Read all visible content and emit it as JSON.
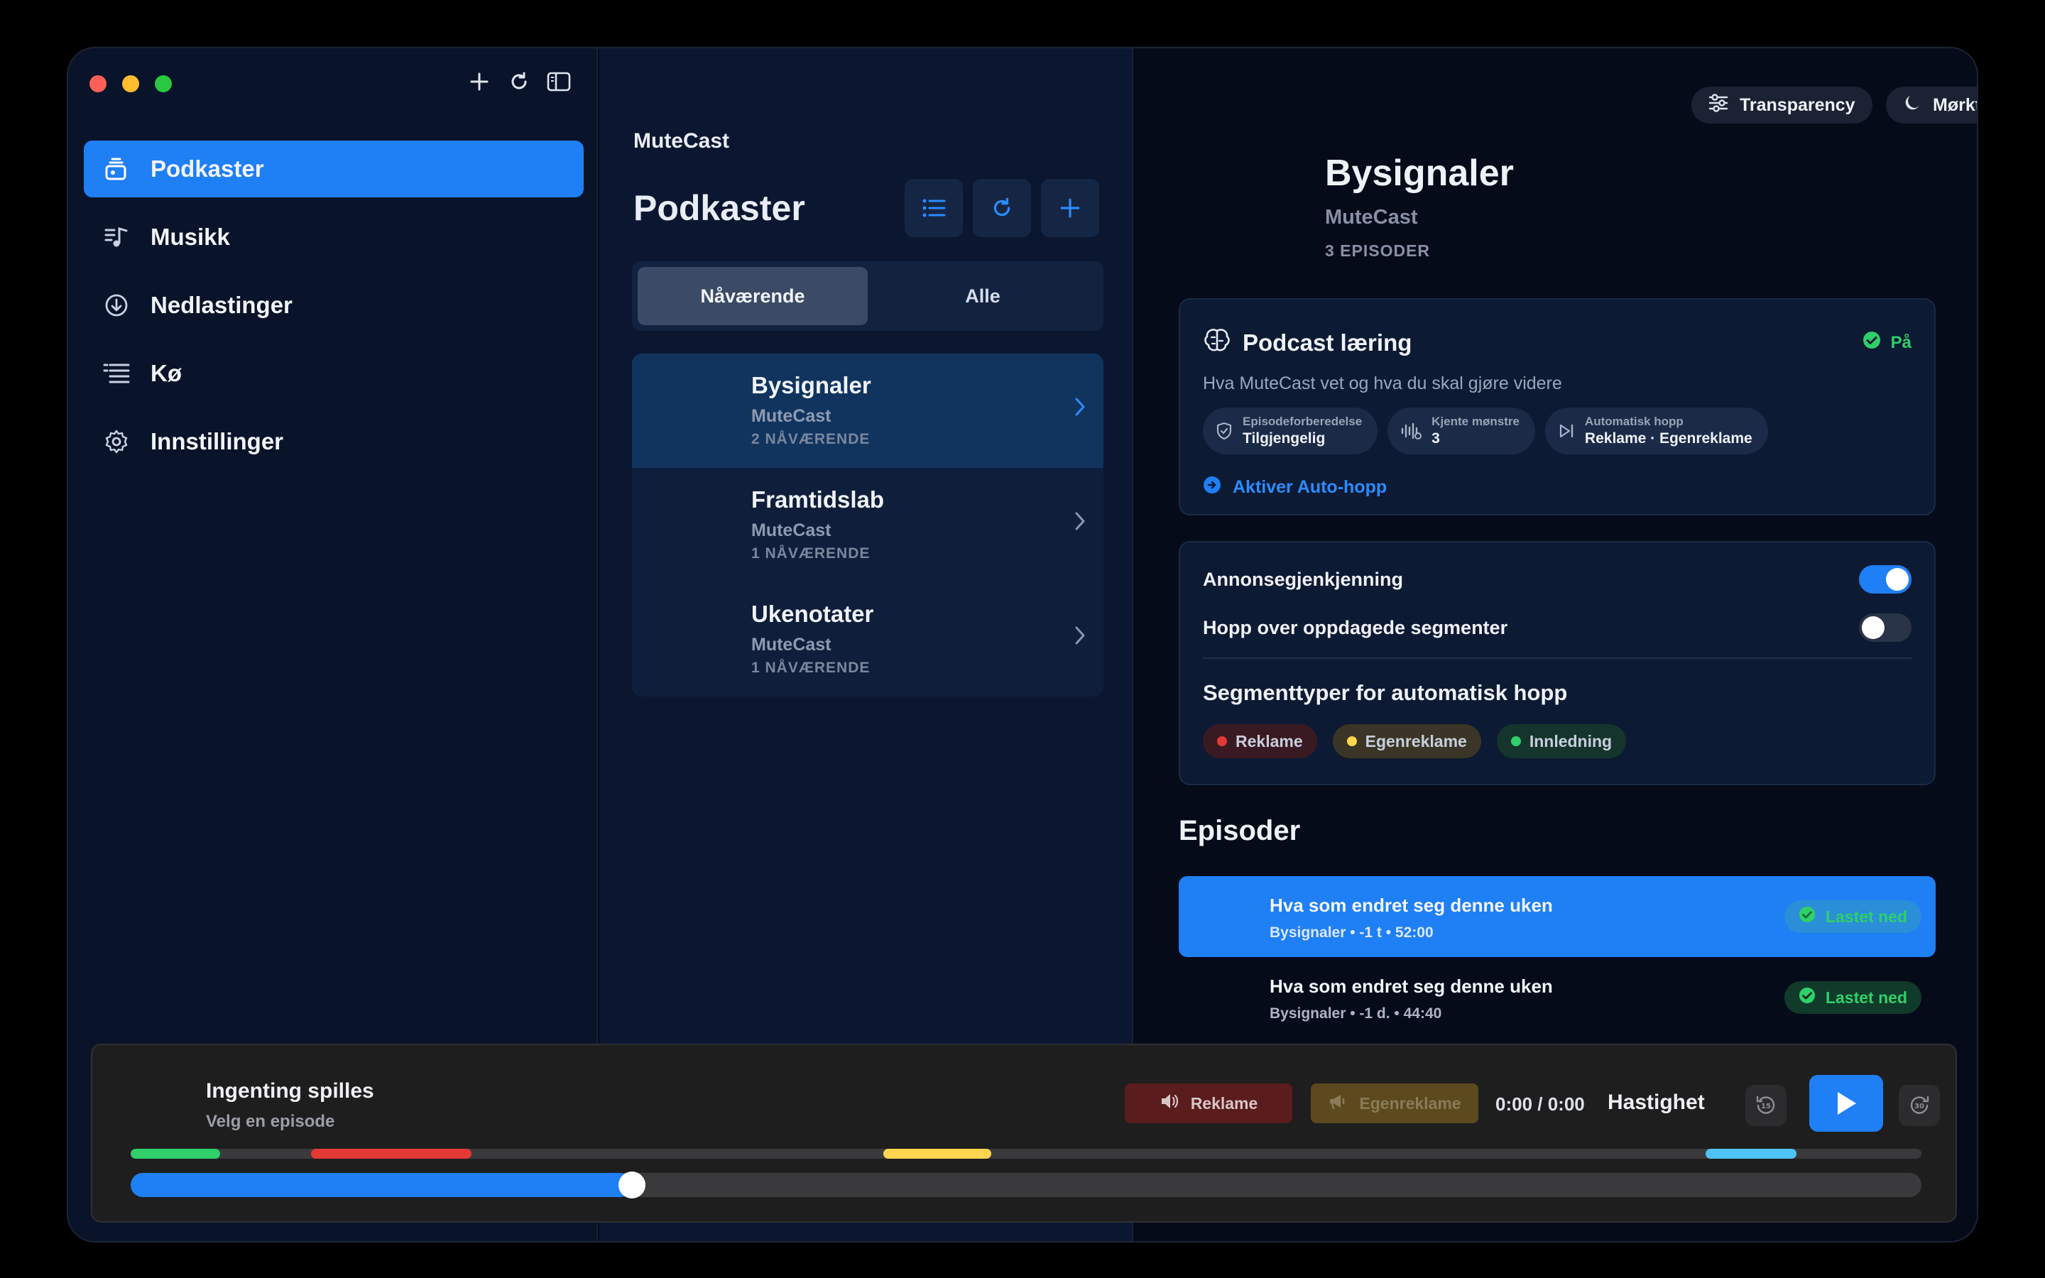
{
  "sidebar": {
    "items": [
      {
        "label": "Podkaster",
        "icon": "podcasts-icon"
      },
      {
        "label": "Musikk",
        "icon": "music-icon"
      },
      {
        "label": "Nedlastinger",
        "icon": "download-icon"
      },
      {
        "label": "Kø",
        "icon": "queue-icon"
      },
      {
        "label": "Innstillinger",
        "icon": "gear-icon"
      }
    ],
    "active_index": 0
  },
  "list": {
    "app_label": "MuteCast",
    "title": "Podkaster",
    "tabs": [
      "Nåværende",
      "Alle"
    ],
    "active_tab": 0,
    "podcasts": [
      {
        "title": "Bysignaler",
        "author": "MuteCast",
        "count": "2 NÅVÆRENDE"
      },
      {
        "title": "Framtidslab",
        "author": "MuteCast",
        "count": "1 NÅVÆRENDE"
      },
      {
        "title": "Ukenotater",
        "author": "MuteCast",
        "count": "1 NÅVÆRENDE"
      }
    ]
  },
  "detail": {
    "transparency_label": "Transparency",
    "theme_label": "Mørkt",
    "title": "Bysignaler",
    "author": "MuteCast",
    "episode_count": "3 EPISODER",
    "learning": {
      "title": "Podcast læring",
      "status": "På",
      "subtitle": "Hva MuteCast vet og hva du skal gjøre videre",
      "chips": [
        {
          "label": "Episodeforberedelse",
          "value": "Tilgjengelig"
        },
        {
          "label": "Kjente mønstre",
          "value": "3"
        },
        {
          "label": "Automatisk hopp",
          "value": "Reklame · Egenreklame"
        }
      ],
      "activate_label": "Aktiver Auto-hopp"
    },
    "settings": {
      "ad_detection_label": "Annonsegjenkjenning",
      "ad_detection_on": true,
      "skip_segments_label": "Hopp over oppdagede segmenter",
      "skip_segments_on": false,
      "segment_types_title": "Segmenttyper for automatisk hopp",
      "segment_types": [
        {
          "label": "Reklame",
          "color": "#e53935"
        },
        {
          "label": "Egenreklame",
          "color": "#ffd54f"
        },
        {
          "label": "Innledning",
          "color": "#2fd069"
        }
      ]
    },
    "episodes_title": "Episoder",
    "episodes": [
      {
        "title": "Hva som endret seg denne uken",
        "meta": "Bysignaler • -1 t • 52:00",
        "badge": "Lastet ned"
      },
      {
        "title": "Hva som endret seg denne uken",
        "meta": "Bysignaler • -1 d. • 44:40",
        "badge": "Lastet ned"
      }
    ]
  },
  "player": {
    "title": "Ingenting spilles",
    "subtitle": "Velg en episode",
    "ad_label": "Reklame",
    "promo_label": "Egenreklame",
    "time": "0:00 / 0:00",
    "speed_label": "Hastighet",
    "skip_back": "15",
    "skip_forward": "30",
    "progress_fraction": 0.28
  },
  "colors": {
    "accent": "#1f7ff5",
    "success": "#2fd069",
    "ad": "#e53935",
    "promo": "#ffd54f",
    "intro": "#2fd069",
    "outro": "#4fc3f7"
  }
}
